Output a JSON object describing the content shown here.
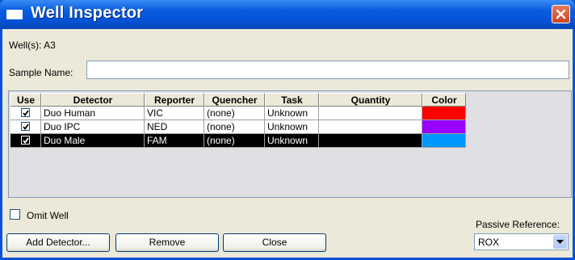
{
  "window": {
    "title": "Well Inspector"
  },
  "wells": {
    "label": "Well(s): A3"
  },
  "sample": {
    "label": "Sample Name:",
    "value": ""
  },
  "table": {
    "headers": [
      "Use",
      "Detector",
      "Reporter",
      "Quencher",
      "Task",
      "Quantity",
      "Color"
    ],
    "rows": [
      {
        "use": true,
        "detector": "Duo Human",
        "reporter": "VIC",
        "quencher": "(none)",
        "task": "Unknown",
        "quantity": "",
        "color": "#ff0000"
      },
      {
        "use": true,
        "detector": "Duo IPC",
        "reporter": "NED",
        "quencher": "(none)",
        "task": "Unknown",
        "quantity": "",
        "color": "#9900ff"
      },
      {
        "use": true,
        "detector": "Duo Male",
        "reporter": "FAM",
        "quencher": "(none)",
        "task": "Unknown",
        "quantity": "",
        "color": "#0099ff"
      }
    ]
  },
  "omit_well": {
    "label": "Omit Well",
    "checked": false
  },
  "passive_reference": {
    "label": "Passive Reference:",
    "value": "ROX"
  },
  "buttons": {
    "add_detector": "Add Detector...",
    "remove": "Remove",
    "close": "Close"
  },
  "icons": {
    "title": "window-icon",
    "close": "close-icon",
    "dropdown": "chevron-down-icon",
    "check": "check-icon"
  }
}
